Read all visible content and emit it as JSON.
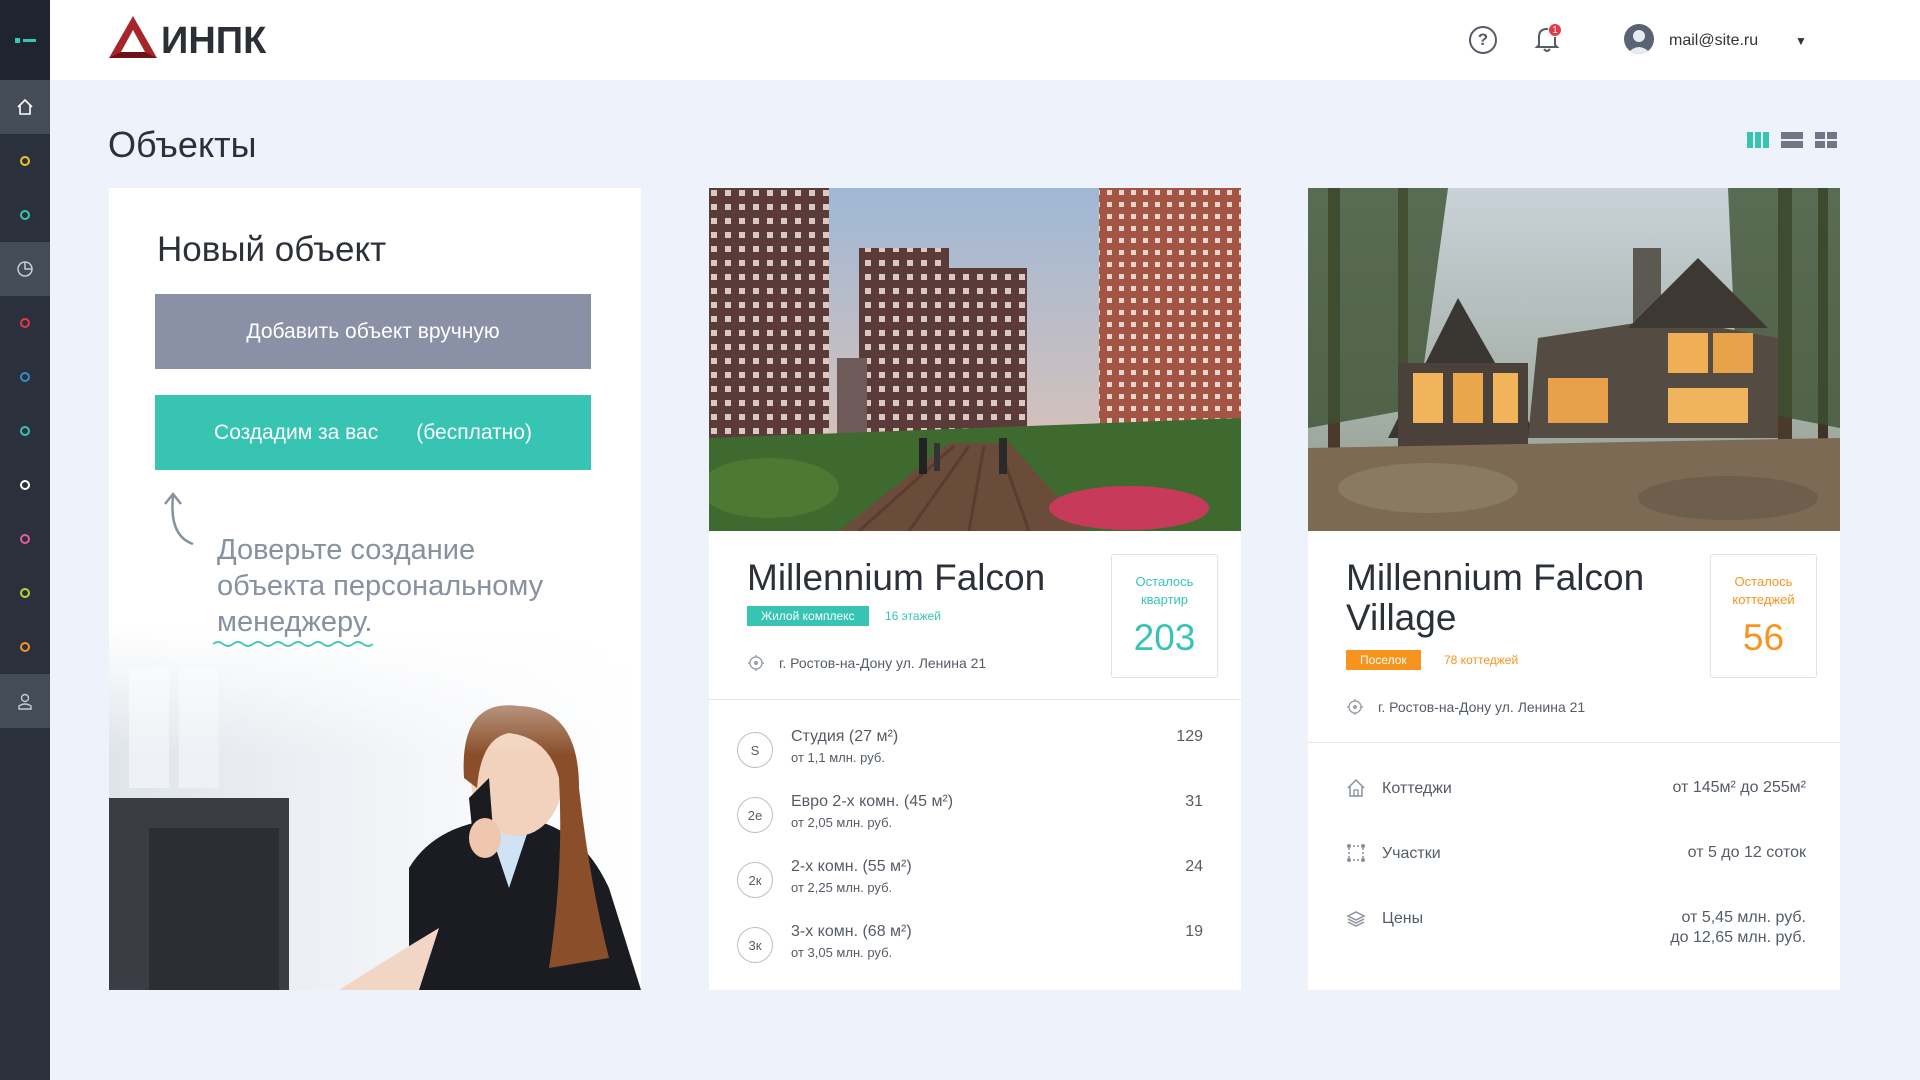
{
  "colors": {
    "accent": "#37c4b3",
    "orange": "#f7941d",
    "sidebar": "#2a313c",
    "manual_btn": "#8a91a6"
  },
  "brand": {
    "name": "ИНПК"
  },
  "header": {
    "user_email": "mail@site.ru",
    "notification_count": "1",
    "help": "?"
  },
  "sidebar": {
    "icons": [
      "home-icon",
      "circle-yellow",
      "circle-teal",
      "pie-chart-icon",
      "circle-red",
      "circle-blue",
      "circle-teal",
      "circle-white",
      "circle-pink",
      "circle-lime",
      "circle-orange",
      "user-icon"
    ]
  },
  "page": {
    "title": "Объекты",
    "view_modes": [
      "columns-view-icon",
      "list-view-icon",
      "grid-view-icon"
    ]
  },
  "new_object": {
    "title": "Новый объект",
    "manual_label": "Добавить объект вручную",
    "create_label": "Создадим за вас",
    "create_note": "(бесплатно)",
    "hint": "Доверьте создание объекта персональному менеджеру."
  },
  "objects": [
    {
      "name": "Millennium Falcon",
      "type": "Жилой комплекс",
      "meta": "16 этажей",
      "address": "г. Ростов-на-Дону ул. Ленина 21",
      "stat_label": "Осталось квартир",
      "stat_value": "203",
      "rows": [
        {
          "code": "S",
          "name": "Студия (27 м²)",
          "price": "от 1,1 млн. руб.",
          "count": "129"
        },
        {
          "code": "2е",
          "name": "Евро 2-х комн. (45 м²)",
          "price": "от 2,05 млн. руб.",
          "count": "31"
        },
        {
          "code": "2к",
          "name": "2-х комн. (55 м²)",
          "price": "от 2,25 млн. руб.",
          "count": "24"
        },
        {
          "code": "3к",
          "name": "3-х комн. (68 м²)",
          "price": "от 3,05 млн. руб.",
          "count": "19"
        }
      ]
    },
    {
      "name": "Millennium Falcon Village",
      "type": "Поселок",
      "meta": "78 коттеджей",
      "address": "г. Ростов-на-Дону ул. Ленина 21",
      "stat_label": "Осталось коттеджей",
      "stat_value": "56",
      "rows": [
        {
          "label": "Коттеджи",
          "value": "от  145м²  до  255м²"
        },
        {
          "label": "Участки",
          "value": "от  5  до  12  соток"
        },
        {
          "label": "Цены",
          "value": "от  5,45  млн. руб.",
          "value2": "до  12,65  млн. руб."
        }
      ]
    }
  ]
}
